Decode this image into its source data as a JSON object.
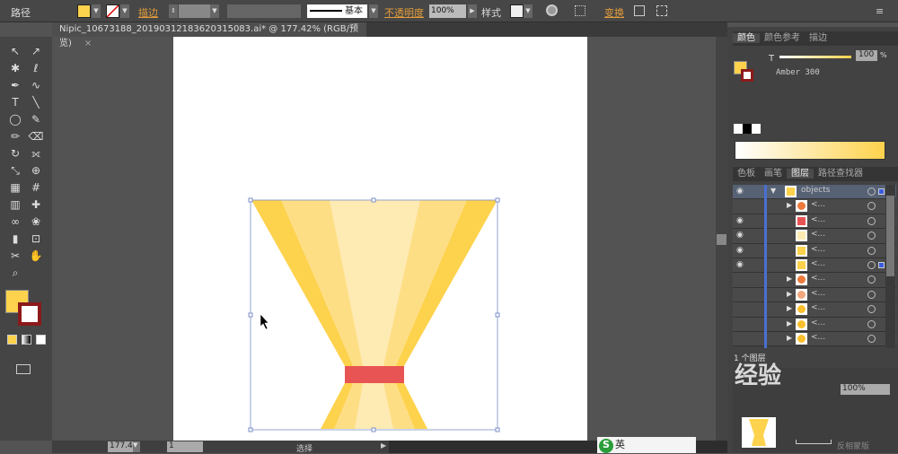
{
  "control_bar": {
    "selection_type": "路径",
    "stroke_label": "描边",
    "stroke_style": "基本",
    "opacity_label": "不透明度",
    "opacity_value": "100%",
    "style_label": "样式",
    "transform_label": "变换",
    "fill_color": "#FDD24C"
  },
  "document_tab": {
    "title": "Nipic_10673188_20190312183620315083.ai* @ 177.42% (RGB/预览)",
    "close": "×"
  },
  "tools": [
    "selection",
    "direct-selection",
    "magic-wand",
    "lasso",
    "pen",
    "curvature",
    "type",
    "line",
    "ellipse",
    "paintbrush",
    "pencil",
    "eraser",
    "rotate",
    "width",
    "free-transform",
    "shape-builder",
    "perspective",
    "mesh",
    "gradient",
    "eyedropper",
    "blend",
    "symbol-sprayer",
    "column-graph",
    "artboard",
    "slice",
    "hand",
    "zoom"
  ],
  "status_bar": {
    "zoom": "177.42",
    "artboard": "1",
    "tool": "选择"
  },
  "color_panel": {
    "tabs": [
      "颜色",
      "颜色参考",
      "描边"
    ],
    "tint_label": "T",
    "tint_value": "100",
    "percent": "%",
    "color_name": "Amber 300"
  },
  "layers_panel": {
    "tabs": [
      "色板",
      "画笔",
      "图层",
      "路径查找器"
    ],
    "active_tab": "图层",
    "layer_name": "objects",
    "sublayer_name": "<...",
    "layer_count": "1 个图层",
    "rows": [
      {
        "visible": true,
        "expand": true,
        "thumb": "#FDD24C",
        "selected": true,
        "name": "objects"
      },
      {
        "visible": false,
        "expand": true,
        "thumb": "#EE7A3B"
      },
      {
        "visible": true,
        "expand": false,
        "thumb": "#E85454"
      },
      {
        "visible": true,
        "expand": false,
        "thumb": "#FEEAB3"
      },
      {
        "visible": true,
        "expand": false,
        "thumb": "#FDD24C"
      },
      {
        "visible": true,
        "expand": false,
        "thumb": "#FDD24C",
        "target_selected": true
      },
      {
        "visible": false,
        "expand": true,
        "thumb": "#EE7A3B"
      },
      {
        "visible": false,
        "expand": true,
        "thumb": "#F3A77D"
      },
      {
        "visible": false,
        "expand": true,
        "thumb": "#FBC02D"
      },
      {
        "visible": false,
        "expand": true,
        "thumb": "#FBC02D"
      },
      {
        "visible": false,
        "expand": true,
        "thumb": "#FBC02D"
      }
    ]
  },
  "transparency_panel": {
    "opacity": "100%",
    "invert_mask": "反相蒙版"
  },
  "watermark": "经验",
  "ime": {
    "lang": "英"
  },
  "colors": {
    "dark": "#FDD24C",
    "mid": "#FEDE85",
    "light": "#FEEAB3",
    "band": "#E85454"
  }
}
